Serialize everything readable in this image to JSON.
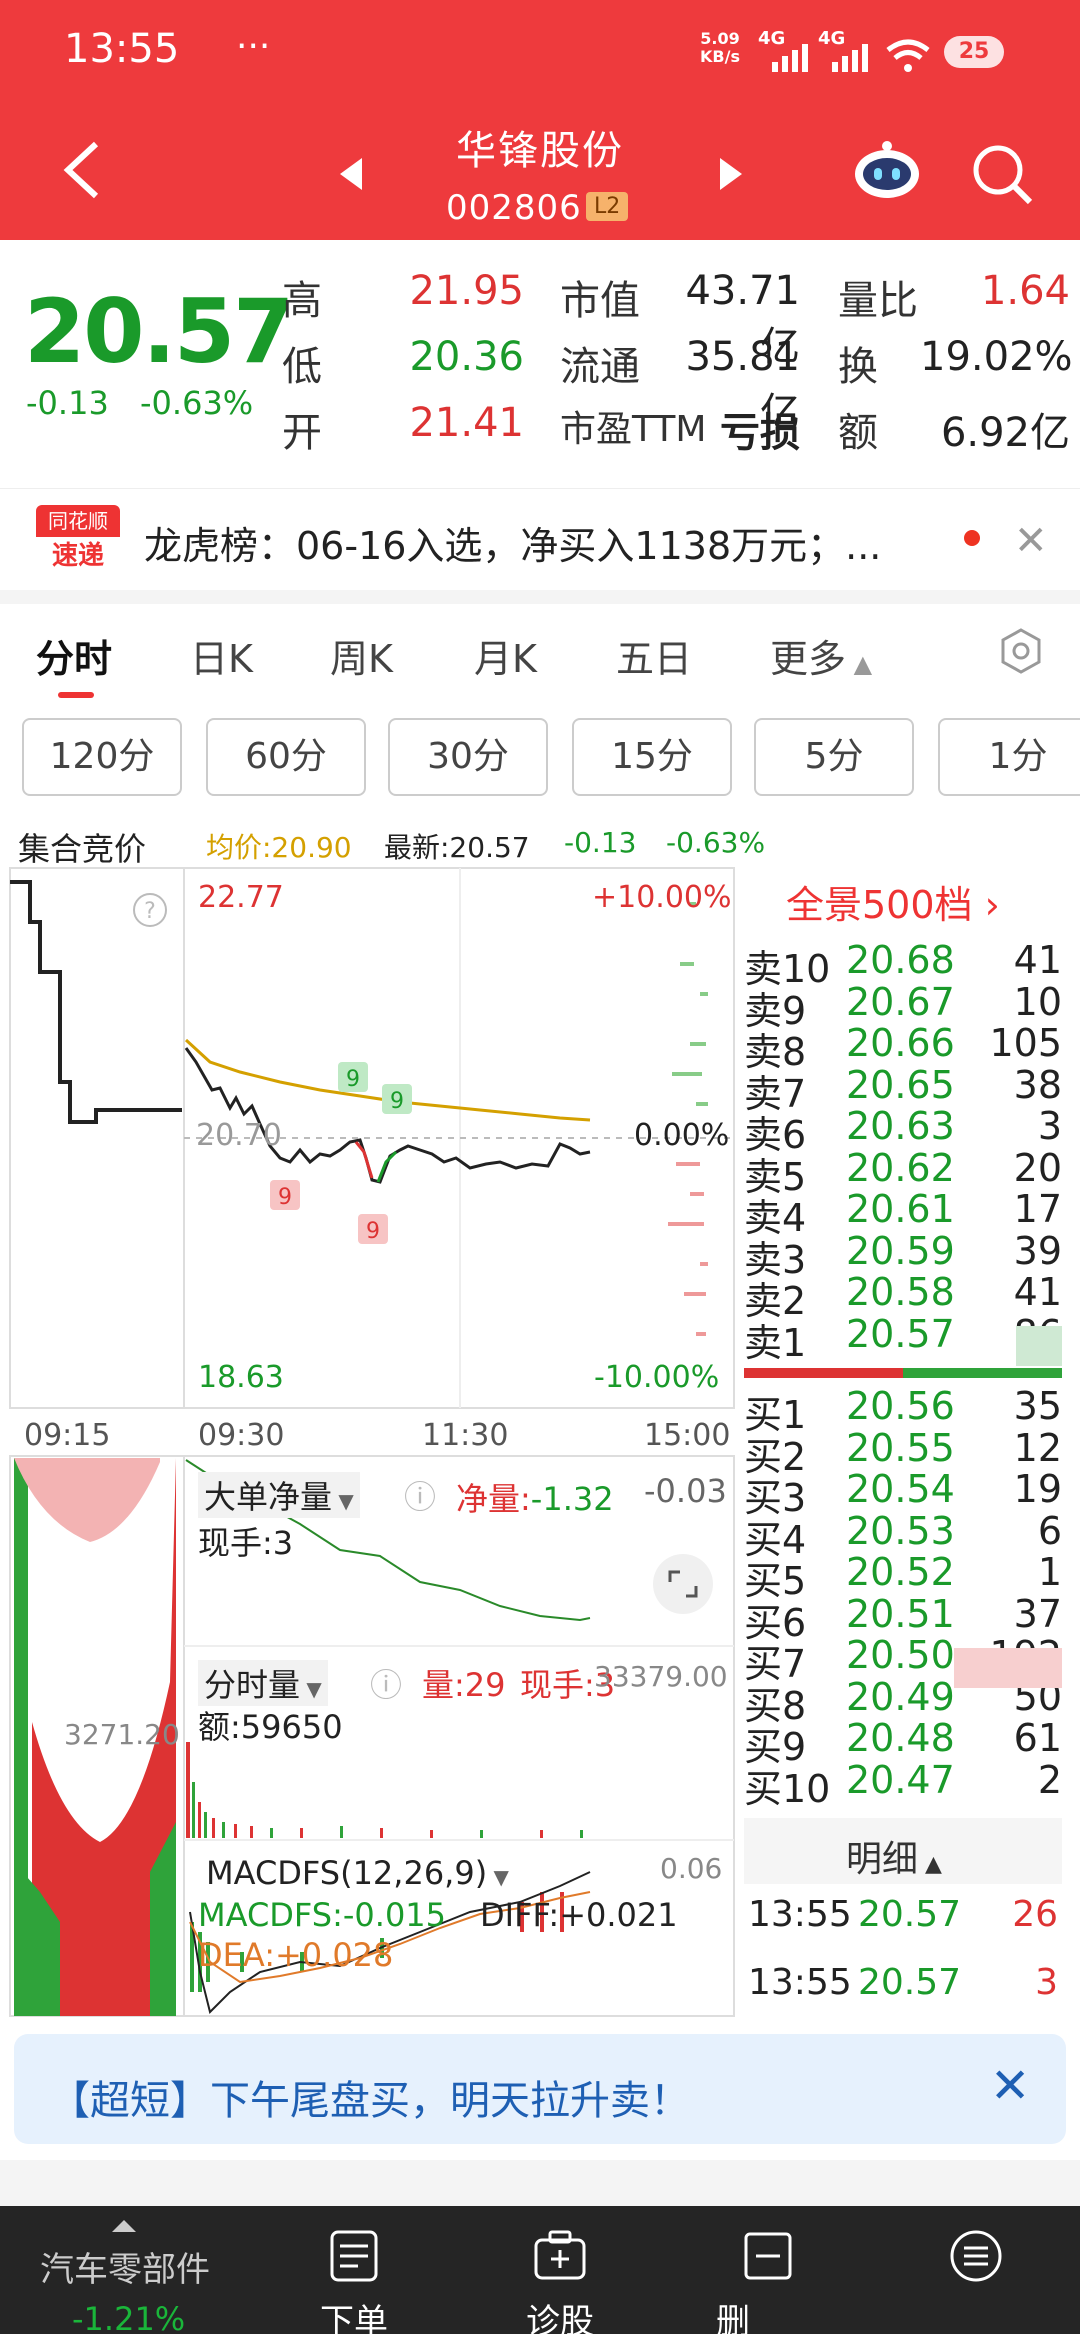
{
  "status": {
    "time": "13:55",
    "dots": "···",
    "speed_top": "5.09",
    "speed_unit": "KB/s",
    "net1": "4G",
    "net2": "4G",
    "battery": "25"
  },
  "header": {
    "title": "华锋股份",
    "code": "002806",
    "badge": "L2"
  },
  "quote": {
    "price": "20.57",
    "change": "-0.13",
    "change_pct": "-0.63%",
    "high_label": "高",
    "high": "21.95",
    "low_label": "低",
    "low": "20.36",
    "open_label": "开",
    "open": "21.41",
    "mcap_label": "市值",
    "mcap": "43.71亿",
    "float_label": "流通",
    "float": "35.81亿",
    "pe_label": "市盈TTM",
    "pe": "亏损",
    "vr_label": "量比",
    "vr": "1.64",
    "turn_label": "换",
    "turn": "19.02%",
    "amt_label": "额",
    "amt": "6.92亿"
  },
  "news": {
    "logo_top": "同花顺",
    "logo_bottom": "速递",
    "text": "龙虎榜：06-16入选，净买入1138万元；..."
  },
  "tabs": [
    "分时",
    "日K",
    "周K",
    "月K",
    "五日",
    "更多"
  ],
  "periods": [
    "120分",
    "60分",
    "30分",
    "15分",
    "5分",
    "1分"
  ],
  "chart_header": {
    "auction": "集合竞价",
    "avg": "均价:20.90",
    "latest": "最新:20.57",
    "chg": "-0.13",
    "chg_pct": "-0.63%"
  },
  "axis": {
    "top_price": "22.77",
    "top_pct": "+10.00%",
    "mid_price": "20.70",
    "mid_pct": "0.00%",
    "bot_price": "18.63",
    "bot_pct": "-10.00%",
    "times": [
      "09:15",
      "09:30",
      "11:30",
      "15:00"
    ],
    "marker": "9"
  },
  "sub1": {
    "name": "大单净量",
    "net_label": "净量:",
    "net": "-1.32",
    "right": "-0.03",
    "hand": "现手:3"
  },
  "sub2": {
    "name": "分时量",
    "vol": "量:29",
    "hand": "现手:3",
    "right": "33379.00",
    "amt": "额:59650",
    "left_vol": "3271.20"
  },
  "sub3": {
    "name": "MACDFS(12,26,9)",
    "right": "0.06",
    "macd": "MACDFS:-0.015",
    "diff": "DIFF:+0.021",
    "dea": "DEA:+0.028"
  },
  "orderbook": {
    "title": "全景500档",
    "asks": [
      {
        "label": "卖10",
        "price": "20.68",
        "vol": "41"
      },
      {
        "label": "卖9",
        "price": "20.67",
        "vol": "10"
      },
      {
        "label": "卖8",
        "price": "20.66",
        "vol": "105"
      },
      {
        "label": "卖7",
        "price": "20.65",
        "vol": "38"
      },
      {
        "label": "卖6",
        "price": "20.63",
        "vol": "3"
      },
      {
        "label": "卖5",
        "price": "20.62",
        "vol": "20"
      },
      {
        "label": "卖4",
        "price": "20.61",
        "vol": "17"
      },
      {
        "label": "卖3",
        "price": "20.59",
        "vol": "39"
      },
      {
        "label": "卖2",
        "price": "20.58",
        "vol": "41"
      },
      {
        "label": "卖1",
        "price": "20.57",
        "vol": "86"
      }
    ],
    "bids": [
      {
        "label": "买1",
        "price": "20.56",
        "vol": "35"
      },
      {
        "label": "买2",
        "price": "20.55",
        "vol": "12"
      },
      {
        "label": "买3",
        "price": "20.54",
        "vol": "19"
      },
      {
        "label": "买4",
        "price": "20.53",
        "vol": "6"
      },
      {
        "label": "买5",
        "price": "20.52",
        "vol": "1"
      },
      {
        "label": "买6",
        "price": "20.51",
        "vol": "37"
      },
      {
        "label": "买7",
        "price": "20.50",
        "vol": "192"
      },
      {
        "label": "买8",
        "price": "20.49",
        "vol": "50"
      },
      {
        "label": "买9",
        "price": "20.48",
        "vol": "61"
      },
      {
        "label": "买10",
        "price": "20.47",
        "vol": "2"
      }
    ],
    "detail_label": "明细",
    "trades": [
      {
        "time": "13:55",
        "price": "20.57",
        "vol": "26"
      },
      {
        "time": "13:55",
        "price": "20.57",
        "vol": "3"
      }
    ]
  },
  "banner": {
    "text": "【超短】下午尾盘买，明天拉升卖！"
  },
  "bottom": {
    "sector": "汽车零部件",
    "sector_chg": "-1.21%",
    "items": [
      "下单",
      "诊股",
      "删"
    ]
  },
  "colors": {
    "header": "#ee3a3d",
    "up": "#d33333",
    "down": "#1a9a2a",
    "avg_line": "#d4a000"
  }
}
